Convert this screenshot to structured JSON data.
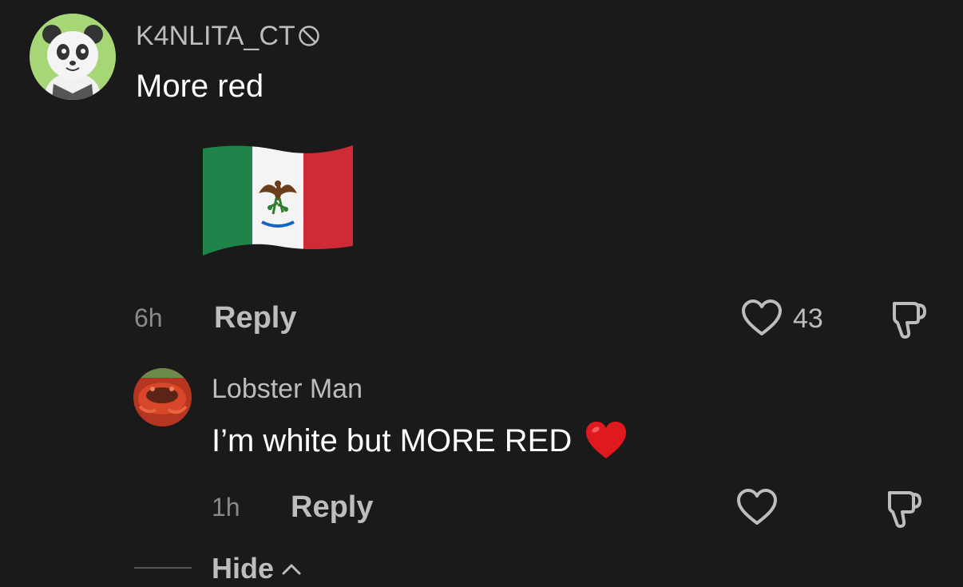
{
  "comments": [
    {
      "username": "K4NLITA_CT",
      "text": "More red",
      "time": "6h",
      "reply_label": "Reply",
      "likes": "43",
      "has_flag_sticker": true
    },
    {
      "username": "Lobster Man",
      "text": "I’m white but MORE RED",
      "time": "1h",
      "reply_label": "Reply",
      "likes": ""
    }
  ],
  "hide_label": "Hide",
  "colors": {
    "background": "#1a1a1a",
    "heart_emoji": "#e0191f",
    "flag_green": "#1e8449",
    "flag_red": "#ce2b37"
  }
}
